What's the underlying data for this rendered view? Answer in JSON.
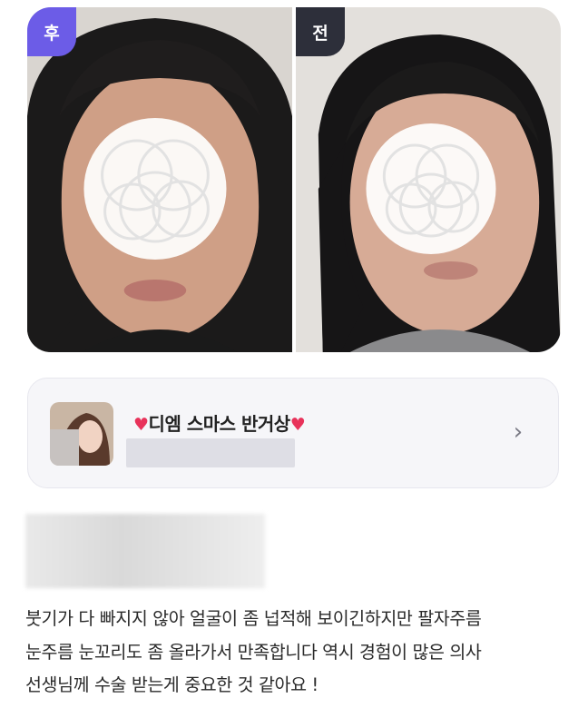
{
  "photos": {
    "after_label": "후",
    "before_label": "전",
    "colors": {
      "after_tag": "#6c5ce7",
      "before_tag": "#2d2f3a"
    }
  },
  "clinic_card": {
    "title_heart_left": "♥",
    "title": "디엠 스마스 반거상",
    "title_heart_right": "♥",
    "chevron_icon": "chevron-right-icon",
    "heart_color": "#e8325a"
  },
  "review": {
    "lines": [
      "붓기가 다 빠지지 않아  얼굴이 좀 넙적해 보이긴하지만 팔자주름",
      "눈주름 눈꼬리도 좀 올라가서 만족합니다 역시 경험이 많은 의사",
      "선생님께 수술 받는게 중요한 것 같아요 !"
    ]
  }
}
